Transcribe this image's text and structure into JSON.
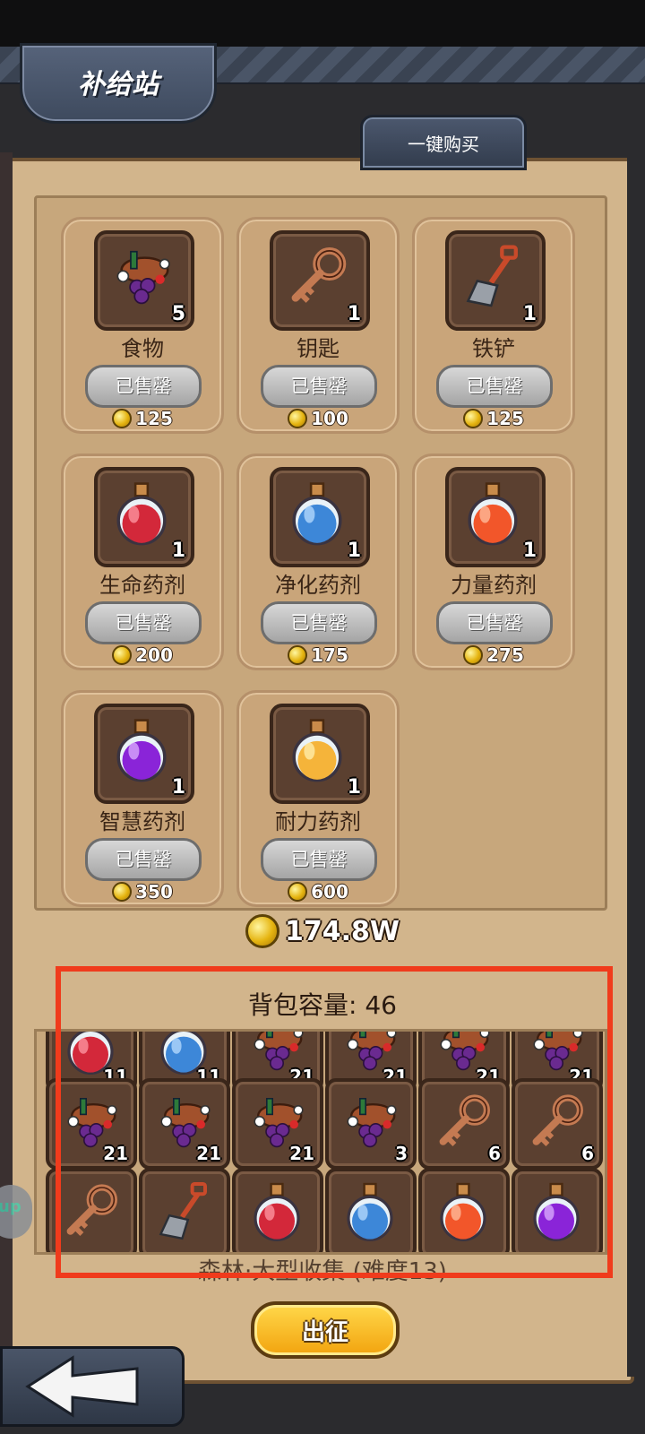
{
  "window": {
    "title": "补给站"
  },
  "buy_all": {
    "label": "一键购买"
  },
  "shop": {
    "sold_label": "已售罄",
    "items": [
      {
        "name": "食物",
        "count": "5",
        "price": "125",
        "icon": "food-icon"
      },
      {
        "name": "钥匙",
        "count": "1",
        "price": "100",
        "icon": "key-icon"
      },
      {
        "name": "铁铲",
        "count": "1",
        "price": "125",
        "icon": "shovel-icon"
      },
      {
        "name": "生命药剂",
        "count": "1",
        "price": "200",
        "icon": "red-potion-icon"
      },
      {
        "name": "净化药剂",
        "count": "1",
        "price": "175",
        "icon": "blue-potion-icon"
      },
      {
        "name": "力量药剂",
        "count": "1",
        "price": "275",
        "icon": "orange-potion-icon"
      },
      {
        "name": "智慧药剂",
        "count": "1",
        "price": "350",
        "icon": "purple-potion-icon"
      },
      {
        "name": "耐力药剂",
        "count": "1",
        "price": "600",
        "icon": "yellow-potion-icon"
      }
    ]
  },
  "gold": {
    "amount": "174.8W"
  },
  "bag": {
    "title": "背包容量: 46",
    "slots": [
      {
        "icon": "red-potion-icon",
        "count": "11"
      },
      {
        "icon": "blue-potion-icon",
        "count": "11"
      },
      {
        "icon": "food-icon",
        "count": "21"
      },
      {
        "icon": "food-icon",
        "count": "21"
      },
      {
        "icon": "food-icon",
        "count": "21"
      },
      {
        "icon": "food-icon",
        "count": "21"
      },
      {
        "icon": "food-icon",
        "count": "21"
      },
      {
        "icon": "food-icon",
        "count": "21"
      },
      {
        "icon": "food-icon",
        "count": "21"
      },
      {
        "icon": "food-icon",
        "count": "3"
      },
      {
        "icon": "key-icon",
        "count": "6"
      },
      {
        "icon": "key-icon",
        "count": "6"
      },
      {
        "icon": "key-icon",
        "count": ""
      },
      {
        "icon": "shovel-icon",
        "count": ""
      },
      {
        "icon": "red-potion-icon",
        "count": ""
      },
      {
        "icon": "blue-potion-icon",
        "count": ""
      },
      {
        "icon": "orange-potion-icon",
        "count": ""
      },
      {
        "icon": "purple-potion-icon",
        "count": ""
      }
    ]
  },
  "expedition": {
    "subtitle": "森林·大型收集 (难度13)",
    "button_label": "出征"
  },
  "side_bubble": {
    "label": "up"
  },
  "colors": {
    "highlight": "#f03b1c",
    "panel": "#d2b58c",
    "sold_button": "#b8b8b8",
    "go_button": "#f7c22a"
  }
}
